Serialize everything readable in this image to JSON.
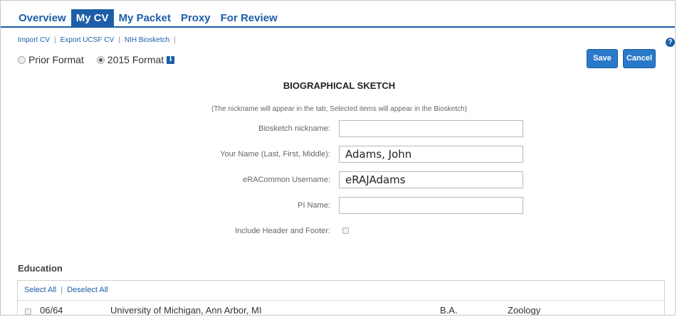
{
  "tabs": [
    {
      "label": "Overview",
      "active": false
    },
    {
      "label": "My CV",
      "active": true
    },
    {
      "label": "My Packet",
      "active": false
    },
    {
      "label": "Proxy",
      "active": false
    },
    {
      "label": "For Review",
      "active": false
    }
  ],
  "sublinks": [
    "Import CV",
    "Export UCSF CV",
    "NIH Biosketch"
  ],
  "help_glyph": "?",
  "formats": [
    {
      "label": "Prior Format",
      "selected": false
    },
    {
      "label": "2015 Format",
      "selected": true
    }
  ],
  "info_glyph": "i",
  "buttons": {
    "save": "Save",
    "cancel": "Cancel"
  },
  "sketch": {
    "title": "BIOGRAPHICAL SKETCH",
    "note": "(The nickname will appear in the tab; Selected items will appear in the Biosketch)"
  },
  "fields": {
    "nickname": {
      "label": "Biosketch nickname:",
      "value": ""
    },
    "name": {
      "label": "Your Name (Last, First, Middle):",
      "value": "Adams, John"
    },
    "era": {
      "label": "eRACommon Username:",
      "value": "eRAJAdams"
    },
    "pi": {
      "label": "PI Name:",
      "value": ""
    },
    "header_footer": {
      "label": "Include Header and Footer:",
      "checked": false
    }
  },
  "education": {
    "title": "Education",
    "select_all": "Select All",
    "deselect_all": "Deselect All",
    "rows": [
      {
        "date": "06/64",
        "institution": "University of Michigan, Ann Arbor, MI",
        "degree": "B.A.",
        "field": "Zoology",
        "checked": false
      }
    ]
  },
  "colors": {
    "brand": "#1c5ea8",
    "button": "#2a79c9"
  }
}
